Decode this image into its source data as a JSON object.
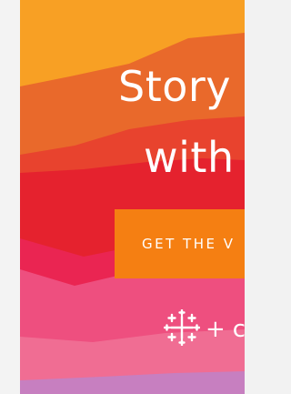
{
  "ad": {
    "headline_line1": "Story",
    "headline_line2": "with",
    "cta_label": "GET THE V",
    "logo_icon": "tableau-cross-icon",
    "logo_plus": "+",
    "logo_partner_text": "c"
  },
  "colors": {
    "orange_top": "#f8a024",
    "orange_dark": "#e9692b",
    "red_orange": "#e8432e",
    "red": "#e5222e",
    "pink_red": "#ea2552",
    "pink": "#ee4f7f",
    "light_pink": "#f06d93",
    "lavender": "#c77fc0",
    "cta_orange": "#f57f12",
    "text": "#ffffff"
  }
}
